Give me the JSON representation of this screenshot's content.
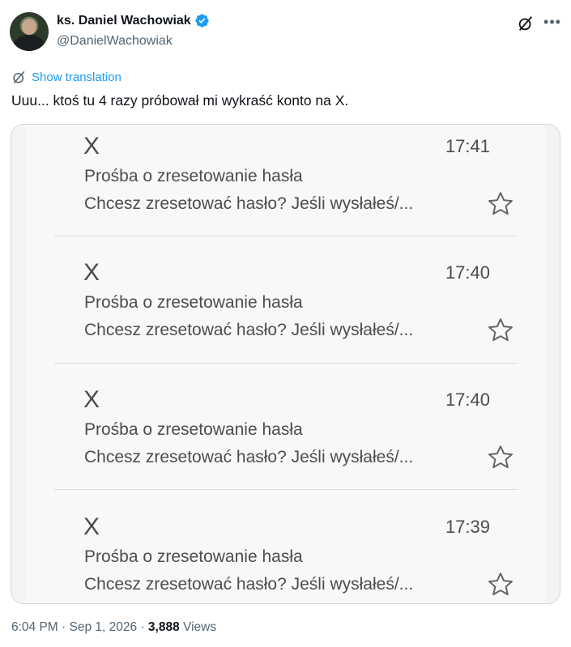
{
  "author": {
    "display_name": "ks. Daniel Wachowiak",
    "handle": "@DanielWachowiak"
  },
  "icons": {
    "verified": "verified-badge-icon",
    "grok": "grok-icon",
    "more": "more-icon",
    "translate": "translate-icon",
    "star": "star-icon"
  },
  "colors": {
    "link_blue": "#1d9bf0",
    "text_primary": "#0f1419",
    "text_secondary": "#536471"
  },
  "translation": {
    "label": "Show translation"
  },
  "tweet": {
    "text": "Uuu... ktoś tu 4 razy próbował mi wykraść konto na X."
  },
  "emails": [
    {
      "sender": "X",
      "time": "17:41",
      "subject": "Prośba o zresetowanie hasła",
      "preview": "Chcesz zresetować hasło? Jeśli wysłałeś/..."
    },
    {
      "sender": "X",
      "time": "17:40",
      "subject": "Prośba o zresetowanie hasła",
      "preview": "Chcesz zresetować hasło? Jeśli wysłałeś/..."
    },
    {
      "sender": "X",
      "time": "17:40",
      "subject": "Prośba o zresetowanie hasła",
      "preview": "Chcesz zresetować hasło? Jeśli wysłałeś/..."
    },
    {
      "sender": "X",
      "time": "17:39",
      "subject": "Prośba o zresetowanie hasła",
      "preview": "Chcesz zresetować hasło? Jeśli wysłałeś/..."
    }
  ],
  "footer": {
    "time": "6:04 PM",
    "sep1": " · ",
    "date": "Sep 1, 2026",
    "sep2": " · ",
    "views_count": "3,888",
    "views_label": " Views"
  }
}
